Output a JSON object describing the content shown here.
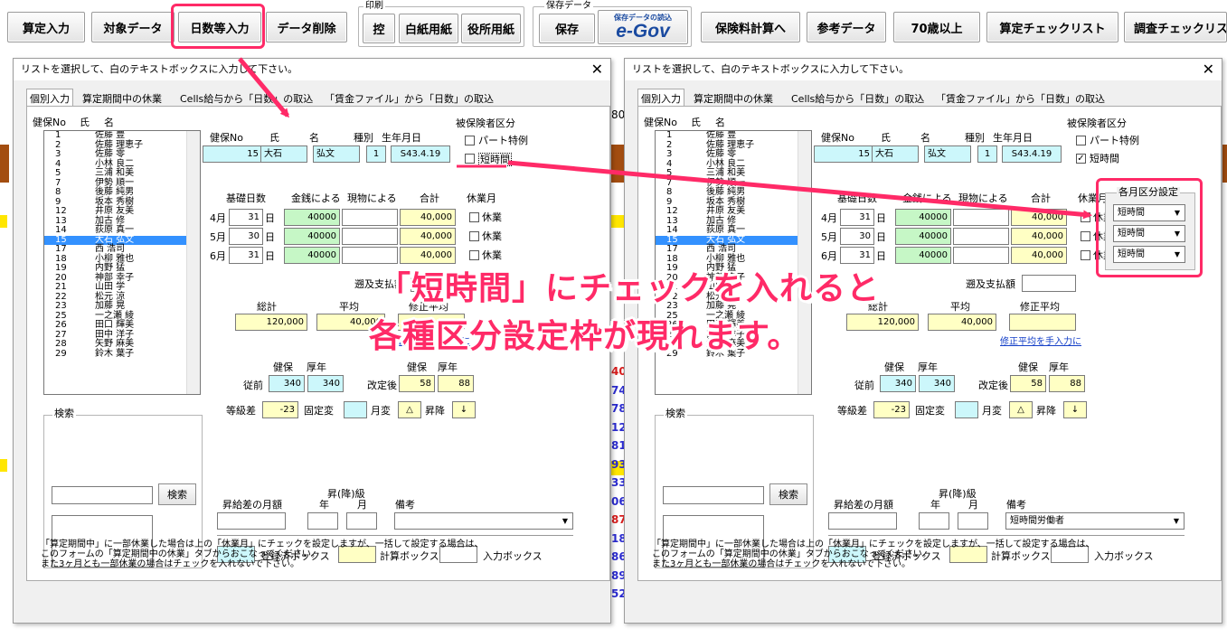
{
  "toolbar": {
    "santei": "算定入力",
    "taisho": "対象データ",
    "nissu": "日数等入力",
    "sakujo": "データ削除",
    "insatsu_group": "印刷",
    "hikae": "控",
    "hakushi": "白紙用紙",
    "yakusho": "役所用紙",
    "hozon_group": "保存データ",
    "hozon": "保存",
    "egov_small": "保存データの読込",
    "egov": "e-Gov",
    "hokenryo": "保険料計算へ",
    "sanko": "参考データ",
    "over70": "70歳以上",
    "check": "算定チェックリスト",
    "chosa": "調査チェックリス"
  },
  "background": {
    "right_numbers": [
      "40",
      "74",
      "78",
      "12",
      "81",
      "93",
      "33",
      "06",
      "87",
      "18",
      "86",
      "89",
      "52"
    ],
    "top_digit": "80"
  },
  "dialog": {
    "title": "リストを選択して、白のテキストボックスに入力して下さい。",
    "close": "✕",
    "tabs": [
      "個別入力",
      "算定期間中の休業",
      "Cells給与から「日数」の取込",
      "「賃金ファイル」から「日数」の取込"
    ],
    "list_header": {
      "no": "健保No",
      "shi": "氏",
      "mei": "名"
    },
    "employees": [
      {
        "no": "1",
        "name": "佐藤 豊"
      },
      {
        "no": "2",
        "name": "佐藤 理恵子"
      },
      {
        "no": "3",
        "name": "佐藤 零"
      },
      {
        "no": "4",
        "name": "小林 良二"
      },
      {
        "no": "5",
        "name": "三浦 和美"
      },
      {
        "no": "7",
        "name": "伊勢 順一"
      },
      {
        "no": "8",
        "name": "後藤 純男"
      },
      {
        "no": "9",
        "name": "坂本 秀樹"
      },
      {
        "no": "12",
        "name": "井原 友美"
      },
      {
        "no": "13",
        "name": "加古 修"
      },
      {
        "no": "14",
        "name": "荻原 真一"
      },
      {
        "no": "15",
        "name": "大石 弘文"
      },
      {
        "no": "17",
        "name": "西 浩司"
      },
      {
        "no": "18",
        "name": "小柳 雅也"
      },
      {
        "no": "19",
        "name": "内野 猛"
      },
      {
        "no": "20",
        "name": "神部 幸子"
      },
      {
        "no": "21",
        "name": "山田 学"
      },
      {
        "no": "22",
        "name": "松元 涼"
      },
      {
        "no": "23",
        "name": "加藤 晃"
      },
      {
        "no": "25",
        "name": "一之瀬 綾"
      },
      {
        "no": "26",
        "name": "田口 輝美"
      },
      {
        "no": "27",
        "name": "田中 洋子"
      },
      {
        "no": "28",
        "name": "矢野 麻美"
      },
      {
        "no": "29",
        "name": "鈴木 葉子"
      }
    ],
    "head_labels": {
      "no": "健保No",
      "shi": "氏",
      "mei": "名",
      "shubetsu": "種別",
      "birth": "生年月日"
    },
    "head_values": {
      "no": "15",
      "shi": "大石",
      "mei": "弘文",
      "shubetsu": "1",
      "birth": "S43.4.19"
    },
    "hihokensha_label": "被保険者区分",
    "part_label": "パート特例",
    "tanjikan_label": "短時間",
    "col_labels": {
      "kiso": "基礎日数",
      "kinsen": "金銭による",
      "genbutsu": "現物による",
      "gokei": "合計",
      "kyugyo": "休業月"
    },
    "months": [
      {
        "m": "4月",
        "days": "31",
        "kinsen": "40000",
        "total": "40,000"
      },
      {
        "m": "5月",
        "days": "30",
        "kinsen": "40000",
        "total": "40,000"
      },
      {
        "m": "6月",
        "days": "31",
        "kinsen": "40000",
        "total": "40,000"
      }
    ],
    "nichi": "日",
    "kyugyo_cb": "休業",
    "sokyu": "遡及支払額",
    "sokei": "総計",
    "heikin": "平均",
    "shusei": "修正平均",
    "sokei_val": "120,000",
    "heikin_val": "40,000",
    "shusei_link": "修正平均を手入力に",
    "kenpo": "健保",
    "kosei": "厚年",
    "juzen": "従前",
    "kaitei": "改定後",
    "juzen_k": "340",
    "juzen_n": "340",
    "kaitei_k": "58",
    "kaitei_n": "88",
    "tokyusa": "等級差",
    "tokyusa_val": "-23",
    "koteihen": "固定変",
    "getsuhen": "月変",
    "shokou": "昇降",
    "tri": "△",
    "down": "↓",
    "search_group": "検索",
    "search_btn": "検索",
    "shokyu_label": "昇(降)級",
    "shokyu_gaku": "昇給差の月額",
    "nen": "年",
    "tsuki": "月",
    "biko": "備考",
    "biko_val": "短時間労働者",
    "legend": {
      "toroku": "登録済ボックス",
      "keisan": "計算ボックス",
      "nyuryoku": "入力ボックス"
    },
    "note": [
      "「算定期間中」に一部休業した場合は上の「休業月」にチェックを設定しますが、一括して設定する場合は、",
      "このフォームの「算定期間中の休業」タブからおこなってください。",
      "また3ヶ月とも一部休業の場合はチェックを入れないで下さい。"
    ],
    "monthly_group": "各月区分設定",
    "monthly_values": [
      "短時間",
      "短時間",
      "短時間"
    ],
    "check_mark": "✓"
  },
  "callout": {
    "line1": "「短時間」にチェックを入れると",
    "line2": "各種区分設定枠が現れます。"
  },
  "colors": {
    "accent": "#ff2a67",
    "selected": "#3391ff"
  }
}
